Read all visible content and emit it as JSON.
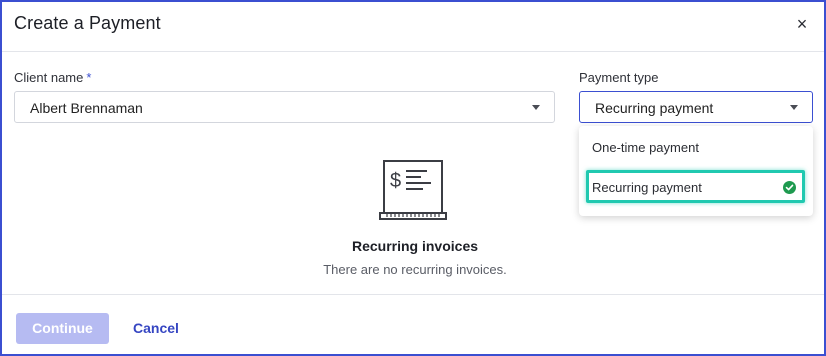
{
  "dialog": {
    "title": "Create a Payment",
    "close_label": "×"
  },
  "client": {
    "label": "Client name",
    "required_marker": "*",
    "value": "Albert Brennaman"
  },
  "payment_type": {
    "label": "Payment type",
    "value": "Recurring payment",
    "options": [
      {
        "label": "One-time payment",
        "selected": false
      },
      {
        "label": "Recurring payment",
        "selected": true
      }
    ]
  },
  "empty_state": {
    "icon": "invoice-icon",
    "title": "Recurring invoices",
    "message": "There are no recurring invoices."
  },
  "footer": {
    "continue_label": "Continue",
    "cancel_label": "Cancel"
  },
  "colors": {
    "accent": "#3b4fd1",
    "highlight": "#20c9b0",
    "success": "#1e9a4f",
    "disabled_button": "#b6bbf2"
  }
}
